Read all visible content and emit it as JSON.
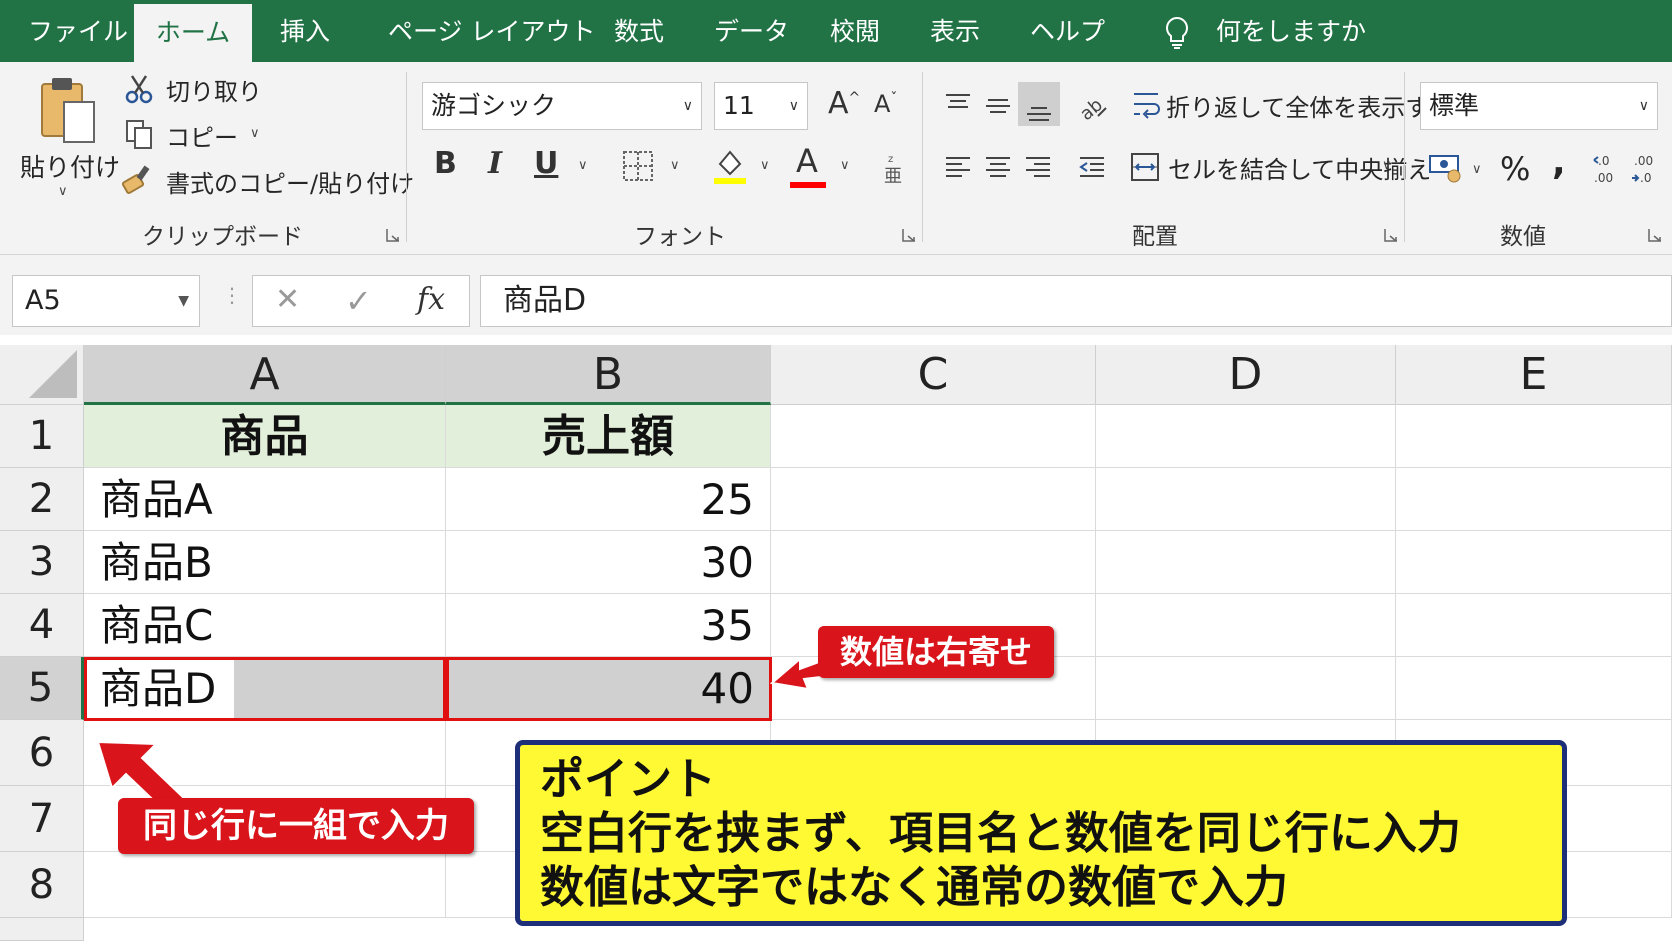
{
  "ribbon_tabs": [
    "ファイル",
    "ホーム",
    "挿入",
    "ページ レイアウト",
    "数式",
    "データ",
    "校閲",
    "表示",
    "ヘルプ"
  ],
  "active_tab": "ホーム",
  "tell_me": "何をしますか",
  "clipboard": {
    "paste": "貼り付け",
    "cut": "切り取り",
    "copy": "コピー",
    "format_painter": "書式のコピー/貼り付け",
    "group_label": "クリップボード"
  },
  "font": {
    "font_name": "游ゴシック",
    "font_size": "11",
    "grow": "A",
    "shrink": "A",
    "bold": "B",
    "italic": "I",
    "underline": "U",
    "font_color_glyph": "A",
    "group_label": "フォント",
    "fill_color": "#ffff00",
    "text_color": "#ff0000"
  },
  "alignment": {
    "wrap_text": "折り返して全体を表示する",
    "merge_center": "セルを結合して中央揃え",
    "group_label": "配置"
  },
  "number": {
    "format": "標準",
    "percent": "%",
    "comma": ",",
    "group_label": "数値"
  },
  "formula_bar": {
    "name_box": "A5",
    "cancel": "✕",
    "enter": "✓",
    "fx": "fx",
    "content": "商品D"
  },
  "sheet": {
    "columns": [
      "A",
      "B",
      "C",
      "D",
      "E"
    ],
    "row_numbers": [
      "1",
      "2",
      "3",
      "4",
      "5",
      "6",
      "7",
      "8"
    ],
    "header": [
      "商品",
      "売上額"
    ],
    "rows": [
      [
        "商品A",
        "25"
      ],
      [
        "商品B",
        "30"
      ],
      [
        "商品C",
        "35"
      ],
      [
        "商品D",
        "40"
      ]
    ],
    "active_cell": "A5"
  },
  "callouts": {
    "right_align": "数値は右寄せ",
    "same_row": "同じ行に一組で入力",
    "point_title": "ポイント",
    "point_line1": "空白行を挟まず、項目名と数値を同じ行に入力",
    "point_line2": "数値は文字ではなく通常の数値で入力"
  },
  "colors": {
    "excel_green": "#217346",
    "header_fill": "#e2efda",
    "callout_red": "#d9141b",
    "point_yellow": "#fff933",
    "point_border": "#1d2f78"
  }
}
